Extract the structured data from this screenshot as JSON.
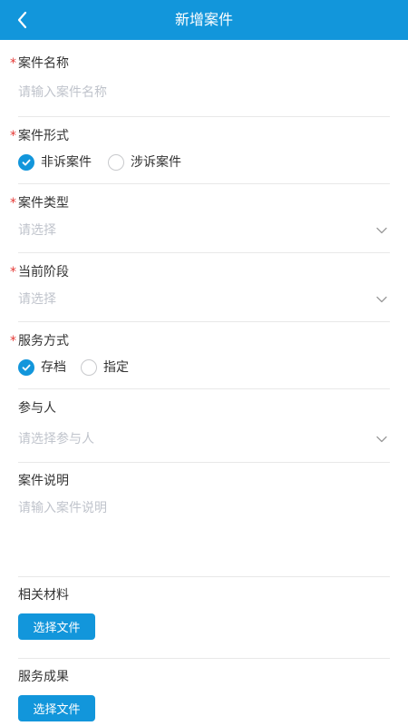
{
  "header": {
    "title": "新增案件"
  },
  "required_mark": "*",
  "case_name": {
    "label": "案件名称",
    "placeholder": "请输入案件名称",
    "value": ""
  },
  "case_form": {
    "label": "案件形式",
    "options": [
      {
        "label": "非诉案件",
        "selected": true
      },
      {
        "label": "涉诉案件",
        "selected": false
      }
    ]
  },
  "case_type": {
    "label": "案件类型",
    "placeholder": "请选择"
  },
  "current_stage": {
    "label": "当前阶段",
    "placeholder": "请选择"
  },
  "service_mode": {
    "label": "服务方式",
    "options": [
      {
        "label": "存档",
        "selected": true
      },
      {
        "label": "指定",
        "selected": false
      }
    ]
  },
  "participants": {
    "label": "参与人",
    "placeholder": "请选择参与人"
  },
  "case_desc": {
    "label": "案件说明",
    "placeholder": "请输入案件说明",
    "value": ""
  },
  "materials": {
    "label": "相关材料",
    "button": "选择文件"
  },
  "results": {
    "label": "服务成果",
    "button": "选择文件"
  },
  "colors": {
    "primary": "#1296db",
    "required": "#e53935",
    "placeholder": "#c0c4cc"
  }
}
